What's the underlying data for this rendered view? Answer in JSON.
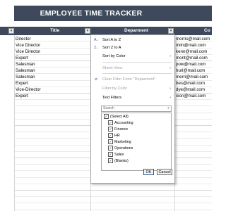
{
  "banner": {
    "title": "EMPLOYEE TIME TRACKER"
  },
  "header": {
    "title": "Title",
    "department": "Deparment",
    "contact": "Co"
  },
  "rows": [
    {
      "title": "Director",
      "contact": "morris@mail.com"
    },
    {
      "title": "Vice Director",
      "contact": "miln@mail.com"
    },
    {
      "title": "Vice Director",
      "contact": "kenn@mail.com"
    },
    {
      "title": "Expert",
      "contact": "mont@mail.com"
    },
    {
      "title": "Salesman",
      "contact": "pow@mail.com"
    },
    {
      "title": "Salesman",
      "contact": "hurl@mail.com"
    },
    {
      "title": "Salesman",
      "contact": "merri@mail.com"
    },
    {
      "title": "Expert",
      "contact": "bes@mail.com"
    },
    {
      "title": "Vice-Director",
      "contact": "dye@mail.com"
    },
    {
      "title": "Expert",
      "contact": "xion@mail.com"
    }
  ],
  "menu": {
    "sort_az": "Sort A to Z",
    "sort_za": "Sort Z to A",
    "sort_color": "Sort by Color",
    "sheet_view": "Sheet View",
    "clear_filter": "Clear Filter From \"Deparment\"",
    "filter_color": "Filter by Color",
    "text_filters": "Text Filters",
    "search_placeholder": "Search",
    "options": [
      "(Select All)",
      "Accounting",
      "Finance",
      "HR",
      "Marketing",
      "Operations",
      "Sales",
      "(Blanks)"
    ],
    "ok": "OK",
    "cancel": "Cancel"
  }
}
